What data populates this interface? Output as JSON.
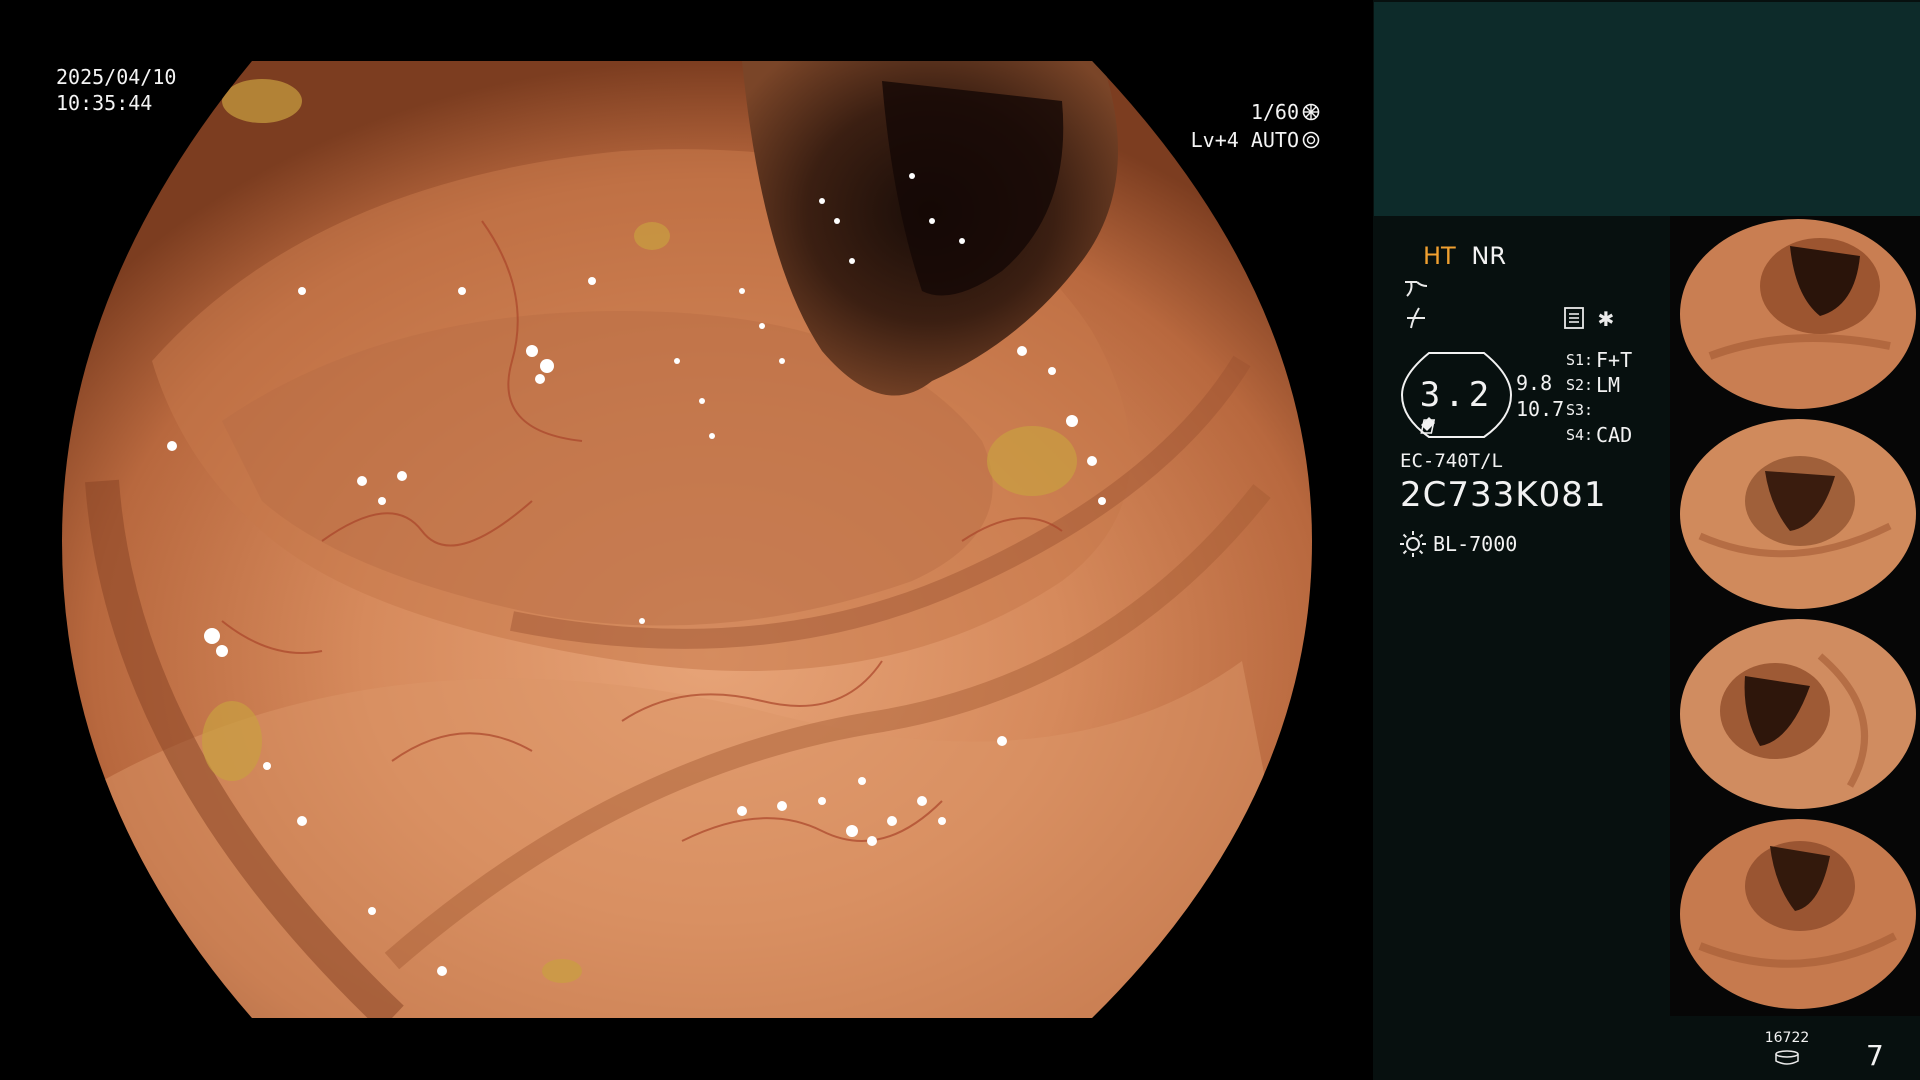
{
  "osd": {
    "date": "2025/04/10",
    "time": "10:35:44",
    "shutter": "1/60",
    "level": "Lv+4 AUTO"
  },
  "panel": {
    "ht_label": "HT",
    "nr_label": "NR",
    "lens_value": "3.2",
    "depth_near": "9.8",
    "depth_far": "10.7",
    "switches": [
      {
        "key": "S1:",
        "value": "F+T"
      },
      {
        "key": "S2:",
        "value": "LM"
      },
      {
        "key": "S3:",
        "value": ""
      },
      {
        "key": "S4:",
        "value": "CAD"
      }
    ],
    "scope_model": "EC-740T/L",
    "scope_serial": "2C733K081",
    "light_source": "BL-7000",
    "storage_count": "16722",
    "page_number": "7"
  },
  "colors": {
    "panel_bg": "#07100f",
    "top_box": "#0d2b2a",
    "ht_accent": "#f0a030",
    "mucosa": "#d98a5c"
  },
  "icons": {
    "shutter": "shutter-wheel-icon",
    "auto": "iris-icon",
    "light": "sun-icon",
    "storage": "disk-icon"
  }
}
